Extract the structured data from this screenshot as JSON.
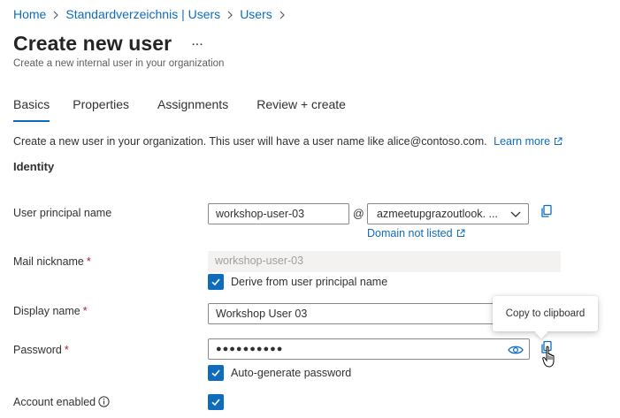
{
  "breadcrumb": {
    "items": [
      "Home",
      "Standardverzeichnis | Users",
      "Users"
    ]
  },
  "page": {
    "title": "Create new user",
    "more_label": "...",
    "subtitle": "Create a new internal user in your organization"
  },
  "tabs": [
    {
      "label": "Basics",
      "active": true
    },
    {
      "label": "Properties",
      "active": false
    },
    {
      "label": "Assignments",
      "active": false
    },
    {
      "label": "Review + create",
      "active": false
    }
  ],
  "intro": {
    "text": "Create a new user in your organization. This user will have a user name like alice@contoso.com.",
    "learn_more": "Learn more"
  },
  "identity": {
    "section_title": "Identity",
    "upn": {
      "label": "User principal name",
      "value": "workshop-user-03",
      "at": "@",
      "domain": "azmeetupgrazoutlook. ...",
      "domain_not_listed": "Domain not listed"
    },
    "mail_nickname": {
      "label": "Mail nickname",
      "required": "*",
      "value": "workshop-user-03",
      "derive_label": "Derive from user principal name"
    },
    "display_name": {
      "label": "Display name",
      "required": "*",
      "value": "Workshop User 03"
    },
    "password": {
      "label": "Password",
      "required": "*",
      "value": "●●●●●●●●●●",
      "auto_generate_label": "Auto-generate password"
    },
    "account_enabled": {
      "label": "Account enabled"
    }
  },
  "tooltip": {
    "text": "Copy to clipboard"
  },
  "colors": {
    "accent": "#0f6cbd",
    "required": "#a4262c",
    "disabled_bg": "#f3f2f1"
  },
  "icons": [
    "chevron-right-icon",
    "external-link-icon",
    "chevron-down-icon",
    "copy-icon",
    "checkmark-icon",
    "eye-icon",
    "info-icon",
    "hand-cursor-icon"
  ]
}
